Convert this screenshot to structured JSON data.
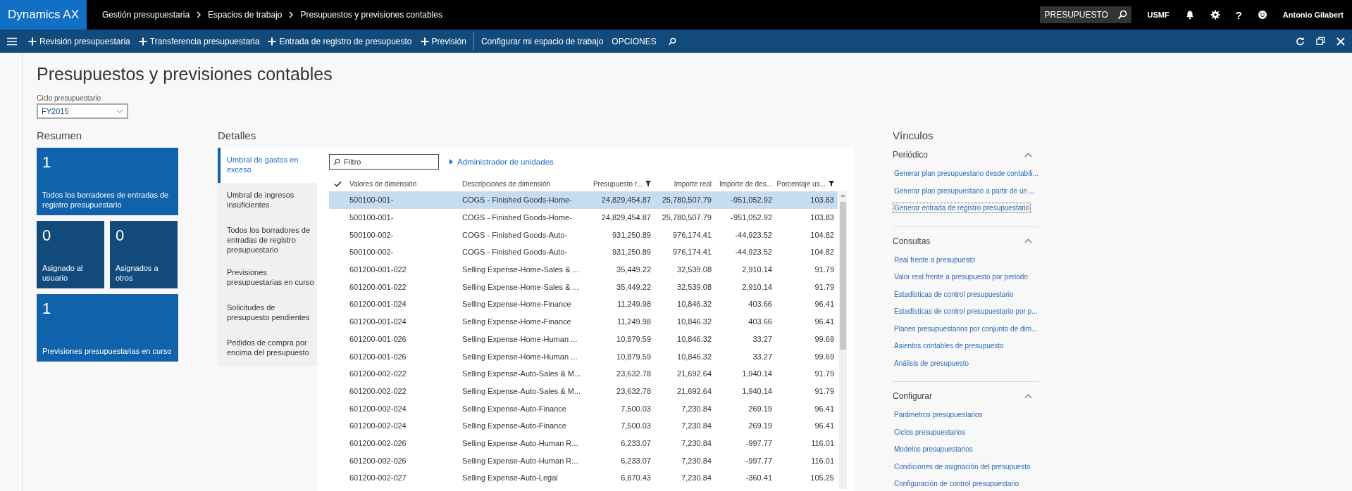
{
  "app": {
    "name": "Dynamics AX"
  },
  "breadcrumb": [
    "Gestión presupuestaria",
    "Espacios de trabajo",
    "Presupuestos y previsiones contables"
  ],
  "search": {
    "value": "PRESUPUESTO"
  },
  "company": "USMF",
  "help": "?",
  "user": "Antonio Gilabert",
  "actions": [
    {
      "label": "Revisión presupuestaria",
      "kind": "add"
    },
    {
      "label": "Transferencia presupuestaria",
      "kind": "add"
    },
    {
      "label": "Entrada de registro de presupuesto",
      "kind": "add"
    },
    {
      "label": "Previsión",
      "kind": "add"
    },
    {
      "label": "Configurar mi espacio de trabajo",
      "kind": "plain"
    },
    {
      "label": "OPCIONES",
      "kind": "plain"
    }
  ],
  "page": {
    "title": "Presupuestos y previsiones contables",
    "cycle": {
      "label": "Ciclo presupuestario",
      "value": "FY2015"
    }
  },
  "summary": {
    "heading": "Resumen",
    "tiles": [
      {
        "count": "1",
        "label": "Todos los borradores de entradas de registro presupuestario",
        "kind": "wide"
      },
      {
        "count": "0",
        "label": "Asignado al usuario",
        "kind": "half"
      },
      {
        "count": "0",
        "label": "Asignados a otros",
        "kind": "half"
      },
      {
        "count": "1",
        "label": "Previsiones presupuestarias en curso",
        "kind": "wide"
      }
    ]
  },
  "details": {
    "heading": "Detalles",
    "tabs": [
      {
        "label": "Umbral de gastos en exceso",
        "selected": true
      },
      {
        "label": "Umbral de ingresos insuficientes",
        "selected": false
      },
      {
        "label": "Todos los borradores de entradas de registro presupuestario",
        "selected": false
      },
      {
        "label": "Previsiones presupuestarias en curso",
        "selected": false
      },
      {
        "label": "Solicitudes de presupuesto pendientes",
        "selected": false
      },
      {
        "label": "Pedidos de compra por encima del presupuesto",
        "selected": false
      }
    ],
    "filter": {
      "placeholder": "Filtro"
    },
    "unit_manager": "Administrador de unidades",
    "columns": [
      {
        "label": "Valores de dimensión",
        "filtered": false
      },
      {
        "label": "Descripciones de dimensión",
        "filtered": false
      },
      {
        "label": "Presupuesto r...",
        "filtered": true
      },
      {
        "label": "Importe real",
        "filtered": false
      },
      {
        "label": "Importe de des...",
        "filtered": false
      },
      {
        "label": "Porcentaje us...",
        "filtered": true
      }
    ],
    "rows": [
      {
        "selected": true,
        "cells": [
          "500100-001-",
          "COGS - Finished Goods-Home-",
          "24,829,454.87",
          "25,780,507.79",
          "-951,052.92",
          "103.83"
        ]
      },
      {
        "selected": false,
        "cells": [
          "500100-001-",
          "COGS - Finished Goods-Home-",
          "24,829,454.87",
          "25,780,507.79",
          "-951,052.92",
          "103.83"
        ]
      },
      {
        "selected": false,
        "cells": [
          "500100-002-",
          "COGS - Finished Goods-Auto-",
          "931,250.89",
          "976,174.41",
          "-44,923.52",
          "104.82"
        ]
      },
      {
        "selected": false,
        "cells": [
          "500100-002-",
          "COGS - Finished Goods-Auto-",
          "931,250.89",
          "976,174.41",
          "-44,923.52",
          "104.82"
        ]
      },
      {
        "selected": false,
        "cells": [
          "601200-001-022",
          "Selling Expense-Home-Sales & ...",
          "35,449.22",
          "32,539.08",
          "2,910.14",
          "91.79"
        ]
      },
      {
        "selected": false,
        "cells": [
          "601200-001-022",
          "Selling Expense-Home-Sales & ...",
          "35,449.22",
          "32,539.08",
          "2,910.14",
          "91.79"
        ]
      },
      {
        "selected": false,
        "cells": [
          "601200-001-024",
          "Selling Expense-Home-Finance",
          "11,249.98",
          "10,846.32",
          "403.66",
          "96.41"
        ]
      },
      {
        "selected": false,
        "cells": [
          "601200-001-024",
          "Selling Expense-Home-Finance",
          "11,249.98",
          "10,846.32",
          "403.66",
          "96.41"
        ]
      },
      {
        "selected": false,
        "cells": [
          "601200-001-026",
          "Selling Expense-Home-Human ...",
          "10,879.59",
          "10,846.32",
          "33.27",
          "99.69"
        ]
      },
      {
        "selected": false,
        "cells": [
          "601200-001-026",
          "Selling Expense-Home-Human ...",
          "10,879.59",
          "10,846.32",
          "33.27",
          "99.69"
        ]
      },
      {
        "selected": false,
        "cells": [
          "601200-002-022",
          "Selling Expense-Auto-Sales & M...",
          "23,632.78",
          "21,692.64",
          "1,940.14",
          "91.79"
        ]
      },
      {
        "selected": false,
        "cells": [
          "601200-002-022",
          "Selling Expense-Auto-Sales & M...",
          "23,632.78",
          "21,692.64",
          "1,940.14",
          "91.79"
        ]
      },
      {
        "selected": false,
        "cells": [
          "601200-002-024",
          "Selling Expense-Auto-Finance",
          "7,500.03",
          "7,230.84",
          "269.19",
          "96.41"
        ]
      },
      {
        "selected": false,
        "cells": [
          "601200-002-024",
          "Selling Expense-Auto-Finance",
          "7,500.03",
          "7,230.84",
          "269.19",
          "96.41"
        ]
      },
      {
        "selected": false,
        "cells": [
          "601200-002-026",
          "Selling Expense-Auto-Human R...",
          "6,233.07",
          "7,230.84",
          "-997.77",
          "116.01"
        ]
      },
      {
        "selected": false,
        "cells": [
          "601200-002-026",
          "Selling Expense-Auto-Human R...",
          "6,233.07",
          "7,230.84",
          "-997.77",
          "116.01"
        ]
      },
      {
        "selected": false,
        "cells": [
          "601200-002-027",
          "Selling Expense-Auto-Legal",
          "6,870.43",
          "7,230.84",
          "-360.41",
          "105.25"
        ]
      }
    ]
  },
  "links": {
    "heading": "Vínculos",
    "sections": [
      {
        "title": "Periódico",
        "expanded": true,
        "items": [
          {
            "label": "Generar plan presupuestario desde contabili...",
            "focused": false
          },
          {
            "label": "Generar plan presupuestario a partir de un ...",
            "focused": false
          },
          {
            "label": "Generar entrada de registro presupuestario",
            "focused": true
          }
        ]
      },
      {
        "title": "Consultas",
        "expanded": true,
        "items": [
          {
            "label": "Real frente a presupuesto",
            "focused": false
          },
          {
            "label": "Valor real frente a presupuesto por periodo",
            "focused": false
          },
          {
            "label": "Estadísticas de control presupuestario",
            "focused": false
          },
          {
            "label": "Estadísticas de control presupuestario por p...",
            "focused": false
          },
          {
            "label": "Planes presupuestarios por conjunto de dim...",
            "focused": false
          },
          {
            "label": "Asientos contables de presupuesto",
            "focused": false
          },
          {
            "label": "Análisis de presupuesto",
            "focused": false
          }
        ]
      },
      {
        "title": "Configurar",
        "expanded": true,
        "items": [
          {
            "label": "Parámetros presupuestarios",
            "focused": false
          },
          {
            "label": "Ciclos presupuestarios",
            "focused": false
          },
          {
            "label": "Modelos presupuestarios",
            "focused": false
          },
          {
            "label": "Condiciones de asignación del presupuesto",
            "focused": false
          },
          {
            "label": "Configuración de control presupuestario",
            "focused": false
          }
        ]
      }
    ]
  }
}
